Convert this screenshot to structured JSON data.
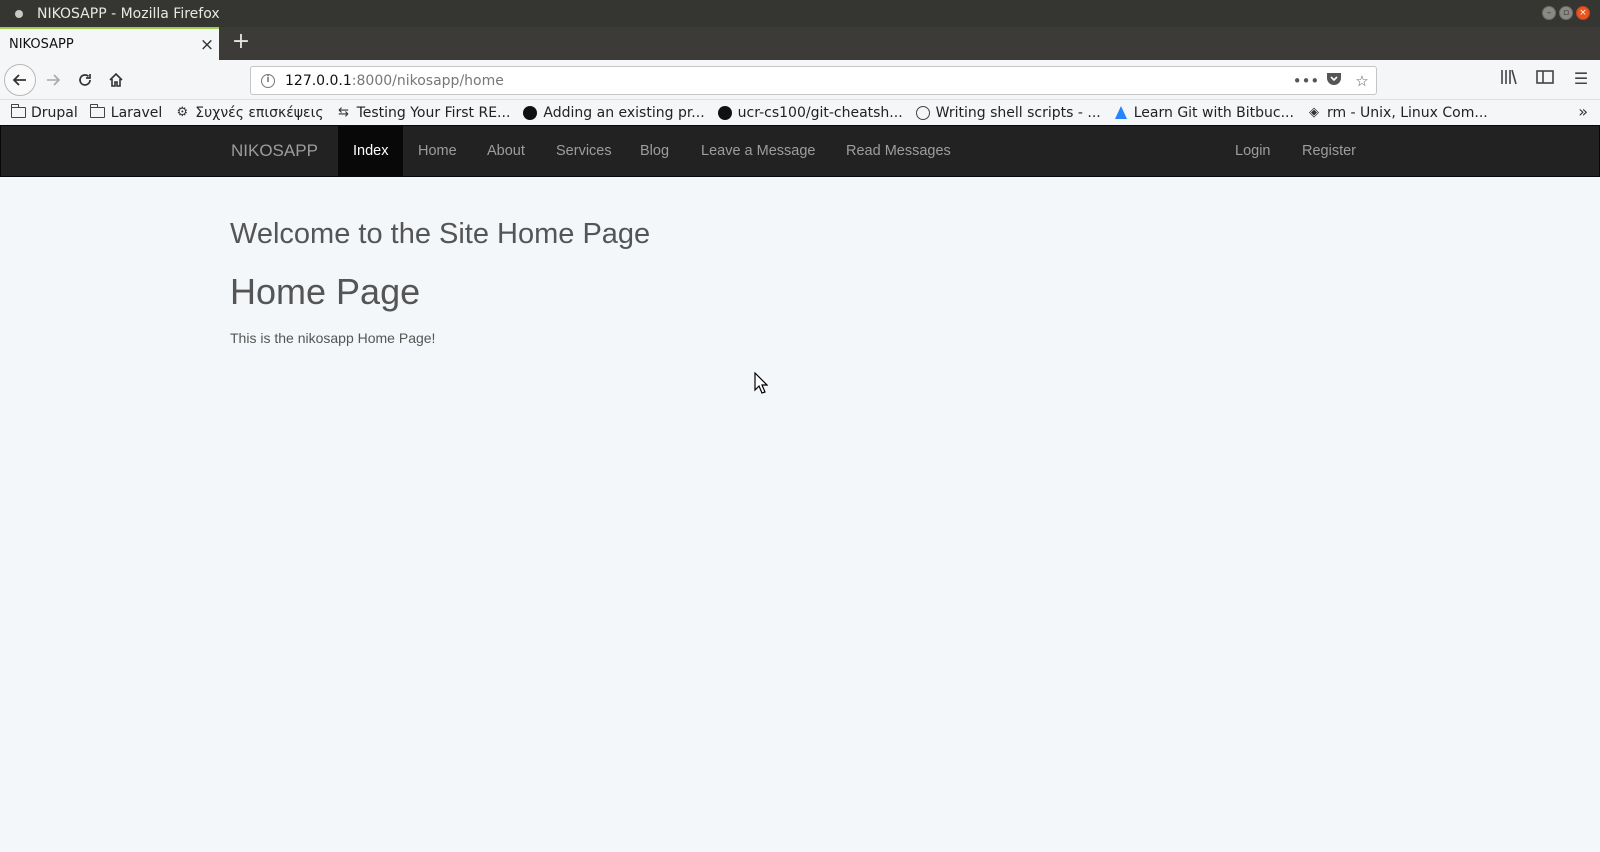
{
  "window": {
    "title": "NIKOSAPP - Mozilla Firefox"
  },
  "tabs": [
    {
      "title": "NIKOSAPP"
    }
  ],
  "address_bar": {
    "host": "127.0.0.1",
    "path": ":8000/nikosapp/home"
  },
  "bookmarks": [
    {
      "label": "Drupal",
      "icon": "folder-icon"
    },
    {
      "label": "Laravel",
      "icon": "folder-icon"
    },
    {
      "label": "Συχνές επισκέψεις",
      "icon": "gear-icon"
    },
    {
      "label": "Testing Your First RE...",
      "icon": "sync-icon"
    },
    {
      "label": "Adding an existing pr...",
      "icon": "github-icon"
    },
    {
      "label": "ucr-cs100/git-cheatsh...",
      "icon": "github-icon"
    },
    {
      "label": "Writing shell scripts - ...",
      "icon": "globe-icon"
    },
    {
      "label": "Learn Git with Bitbuc...",
      "icon": "atlassian-icon"
    },
    {
      "label": "rm - Unix, Linux Com...",
      "icon": "diamond-icon"
    }
  ],
  "site_nav": {
    "brand": "NIKOSAPP",
    "links": [
      {
        "label": "Index",
        "active": true
      },
      {
        "label": "Home"
      },
      {
        "label": "About"
      },
      {
        "label": "Services"
      },
      {
        "label": "Blog"
      },
      {
        "label": "Leave a Message"
      },
      {
        "label": "Read Messages"
      }
    ],
    "right_links": [
      {
        "label": "Login"
      },
      {
        "label": "Register"
      }
    ]
  },
  "content": {
    "welcome": "Welcome to the Site Home Page",
    "heading": "Home Page",
    "text": "This is the nikosapp Home Page!"
  }
}
